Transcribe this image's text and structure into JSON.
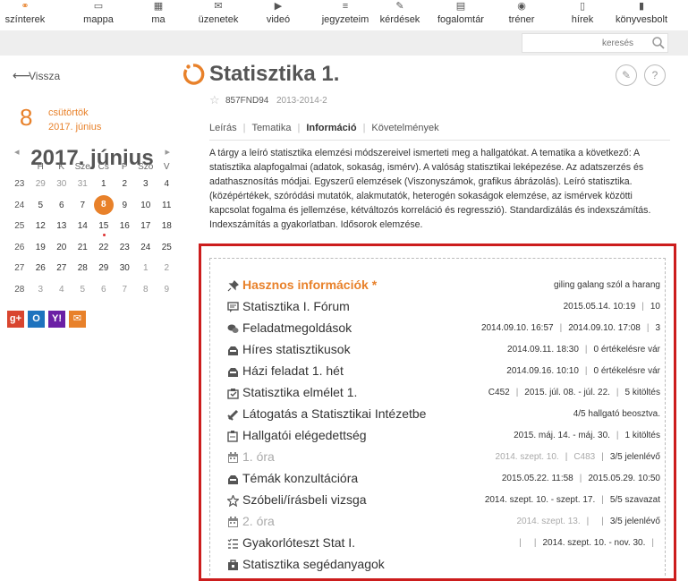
{
  "nav": {
    "items": [
      {
        "label": "színterek",
        "icon": "network-icon"
      },
      {
        "label": "mappa",
        "icon": "folder-icon"
      },
      {
        "label": "ma",
        "icon": "calendar-icon"
      },
      {
        "label": "üzenetek",
        "icon": "envelope-icon"
      },
      {
        "label": "videó",
        "icon": "video-icon"
      },
      {
        "label": "jegyzeteim",
        "icon": "notes-icon"
      },
      {
        "label": "kérdések",
        "icon": "question-icon"
      },
      {
        "label": "fogalomtár",
        "icon": "glossary-icon"
      },
      {
        "label": "tréner",
        "icon": "trainer-icon"
      },
      {
        "label": "hírek",
        "icon": "news-icon"
      },
      {
        "label": "könyvesbolt",
        "icon": "bookstore-icon"
      }
    ]
  },
  "search": {
    "placeholder": "keresés"
  },
  "left": {
    "back_label": "Vissza",
    "date_day": "8",
    "date_weekday": "csütörtök",
    "date_month": "2017. június",
    "calendar": {
      "title": "2017. június",
      "prev": "◂",
      "next": "▸",
      "weekdays": [
        "H",
        "K",
        "Sze",
        "Cs",
        "P",
        "Szo",
        "V"
      ],
      "weeks": [
        {
          "wk": "23",
          "days": [
            "29",
            "30",
            "31",
            "1",
            "2",
            "3",
            "4"
          ]
        },
        {
          "wk": "24",
          "days": [
            "5",
            "6",
            "7",
            "8",
            "9",
            "10",
            "11"
          ]
        },
        {
          "wk": "25",
          "days": [
            "12",
            "13",
            "14",
            "15",
            "16",
            "17",
            "18"
          ]
        },
        {
          "wk": "26",
          "days": [
            "19",
            "20",
            "21",
            "22",
            "23",
            "24",
            "25"
          ]
        },
        {
          "wk": "27",
          "days": [
            "26",
            "27",
            "28",
            "29",
            "30",
            "1",
            "2"
          ]
        },
        {
          "wk": "28",
          "days": [
            "3",
            "4",
            "5",
            "6",
            "7",
            "8",
            "9"
          ]
        }
      ]
    },
    "social": [
      {
        "name": "google",
        "text": "g+",
        "color": "#d9452f"
      },
      {
        "name": "outlook",
        "text": "O",
        "color": "#1e73be"
      },
      {
        "name": "yahoo",
        "text": "Y!",
        "color": "#6b1fa5"
      },
      {
        "name": "mail",
        "text": "✉",
        "color": "#e8812a"
      }
    ]
  },
  "course": {
    "title": "Statisztika 1.",
    "code": "857FND94",
    "year": "2013-2014-2",
    "edit_icon": "✎",
    "help_icon": "?",
    "tabs": [
      "Leírás",
      "Tematika",
      "Információ",
      "Követelmények"
    ],
    "active_tab": "Információ",
    "description": "A tárgy a leíró statisztika elemzési módszereivel ismerteti meg a hallgatókat.  A tematika a következő: A statisztika alapfogalmai (adatok, sokaság, ismérv). A valóság statisztikai leképezése. Az adatszerzés és adathasznosítás módjai. Egyszerű elemzések (Viszonyszámok, grafikus ábrázolás). Leíró statisztika. (középértékek, szóródási mutatók, alakmutatók, heterogén sokaságok elemzése, az ismérvek közötti kapcsolat fogalma és jellemzése, kétváltozós korreláció és regresszió). Standardizálás és indexszámítás. Indexszámítás a gyakorlatban. Idősorok elemzése."
  },
  "items": [
    {
      "icon": "pin-icon",
      "name": "Hasznos információk *",
      "style": "hl",
      "meta": [
        "giling galang szól a harang"
      ]
    },
    {
      "icon": "forum-icon",
      "name": "Statisztika I. Fórum",
      "meta": [
        "2015.05.14. 10:19",
        "10"
      ]
    },
    {
      "icon": "chat-icon",
      "name": "Feladatmegoldások",
      "meta": [
        "2014.09.10. 16:57",
        "2014.09.10. 17:08",
        "3"
      ]
    },
    {
      "icon": "inbox-icon",
      "name": "Híres statisztikusok",
      "meta": [
        "2014.09.11. 18:30",
        "0 értékelésre vár"
      ]
    },
    {
      "icon": "inbox-icon",
      "name": "Házi feladat 1. hét",
      "meta": [
        "2014.09.16. 10:10",
        "0 értékelésre vár"
      ]
    },
    {
      "icon": "test-icon",
      "name": "Statisztika elmélet 1.",
      "meta": [
        "C452",
        "2015. júl. 08. - júl. 22.",
        "5 kitöltés"
      ]
    },
    {
      "icon": "link-icon",
      "name": "Látogatás a Statisztikai Intézetbe",
      "meta": [
        "4/5 hallgató beosztva."
      ]
    },
    {
      "icon": "survey-icon",
      "name": "Hallgatói elégedettség",
      "meta": [
        "2015. máj. 14. - máj. 30.",
        "1 kitöltés"
      ]
    },
    {
      "icon": "calendar-icon",
      "name": "1. óra",
      "style": "dim",
      "meta": [
        "2014. szept. 10.",
        "C483",
        "3/5 jelenlévő"
      ],
      "meta_dim": 2
    },
    {
      "icon": "inbox-icon",
      "name": "Témák konzultációra",
      "meta": [
        "2015.05.22. 11:58",
        "2015.05.29. 10:50"
      ]
    },
    {
      "icon": "exam-icon",
      "name": "Szóbeli/írásbeli vizsga",
      "meta": [
        "2014. szept. 10. - szept. 17.",
        "5/5 szavazat"
      ]
    },
    {
      "icon": "calendar-icon",
      "name": "2. óra",
      "style": "dim",
      "meta": [
        "2014. szept. 13.",
        "",
        "3/5 jelenlévő"
      ],
      "meta_dim": 2
    },
    {
      "icon": "quiz-icon",
      "name": "Gyakorlóteszt Stat I.",
      "meta": [
        "",
        "2014. szept. 10. - nov. 30.",
        ""
      ]
    },
    {
      "icon": "material-icon",
      "name": "Statisztika segédanyagok",
      "meta": []
    }
  ],
  "colors": {
    "accent": "#e8812a",
    "highlight_border": "#cc1d1d"
  }
}
